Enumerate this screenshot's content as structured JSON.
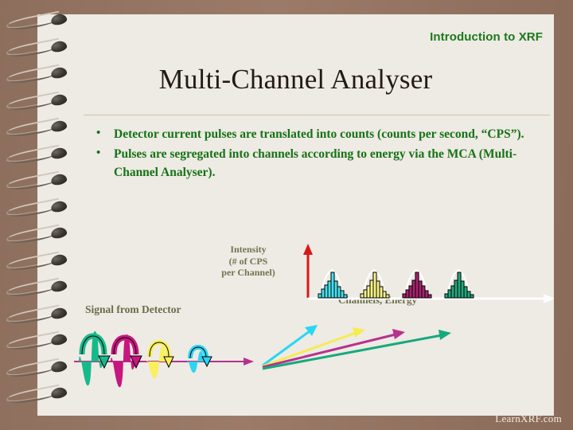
{
  "header": {
    "text": "Introduction to XRF"
  },
  "title": {
    "text": "Multi-Channel Analyser"
  },
  "bullets": [
    {
      "marker": "•",
      "text": "Detector current pulses are translated into counts (counts per second, “CPS”)."
    },
    {
      "marker": "•",
      "text": "Pulses are segregated into channels according to energy via the MCA (Multi-Channel Analyser)."
    }
  ],
  "diagram": {
    "y_axis_label": "Intensity\n(# of CPS\nper Channel)",
    "y_axis_label_line1": "Intensity",
    "y_axis_label_line2": "(# of CPS",
    "y_axis_label_line3": "per Channel)",
    "x_axis_label": "Channels, Energy",
    "signal_label": "Signal from Detector",
    "axis_arrow_vertical_color": "#e01b1b",
    "axis_arrow_horizontal_color": "#ffffff",
    "baseline_color": "#b5338f",
    "pulses": [
      {
        "name": "pulse-teal",
        "color": "#16b98a"
      },
      {
        "name": "pulse-magenta",
        "color": "#c7167f"
      },
      {
        "name": "pulse-yellow",
        "color": "#faf05a"
      },
      {
        "name": "pulse-cyan",
        "color": "#2ad6f2"
      }
    ],
    "routing_arrows": [
      {
        "name": "route-cyan",
        "color": "#2ad6f2"
      },
      {
        "name": "route-yellow",
        "color": "#f5ec52"
      },
      {
        "name": "route-magenta",
        "color": "#b5338f"
      },
      {
        "name": "route-teal",
        "color": "#16a97c"
      }
    ]
  },
  "chart_data": {
    "type": "bar",
    "title": "",
    "xlabel": "Channels, Energy",
    "ylabel": "Intensity (# of CPS per Channel)",
    "grid": false,
    "legend": "none",
    "ylim": [
      0,
      10
    ],
    "note": "Four gaussian-shaped channel groups, one per detector pulse energy; bar heights in arbitrary CPS units.",
    "series": [
      {
        "name": "peak-cyan",
        "color": "#2ad6f2",
        "x_offset": 0,
        "values": [
          1,
          3,
          5,
          6,
          9,
          6,
          4,
          3,
          1
        ]
      },
      {
        "name": "peak-yellow",
        "color": "#faf05a",
        "x_offset": 10,
        "values": [
          1,
          2,
          4,
          6,
          9,
          6,
          4,
          2,
          1
        ]
      },
      {
        "name": "peak-magenta",
        "color": "#a8246e",
        "x_offset": 20,
        "values": [
          1,
          2,
          4,
          6,
          9,
          6,
          4,
          3,
          1
        ]
      },
      {
        "name": "peak-teal",
        "color": "#1aa87a",
        "x_offset": 30,
        "values": [
          1,
          2,
          4,
          6,
          9,
          6,
          4,
          2,
          1
        ]
      }
    ],
    "envelope": "gaussian outline drawn in white over each group"
  },
  "footer": {
    "text": "LearnXRF.com"
  }
}
